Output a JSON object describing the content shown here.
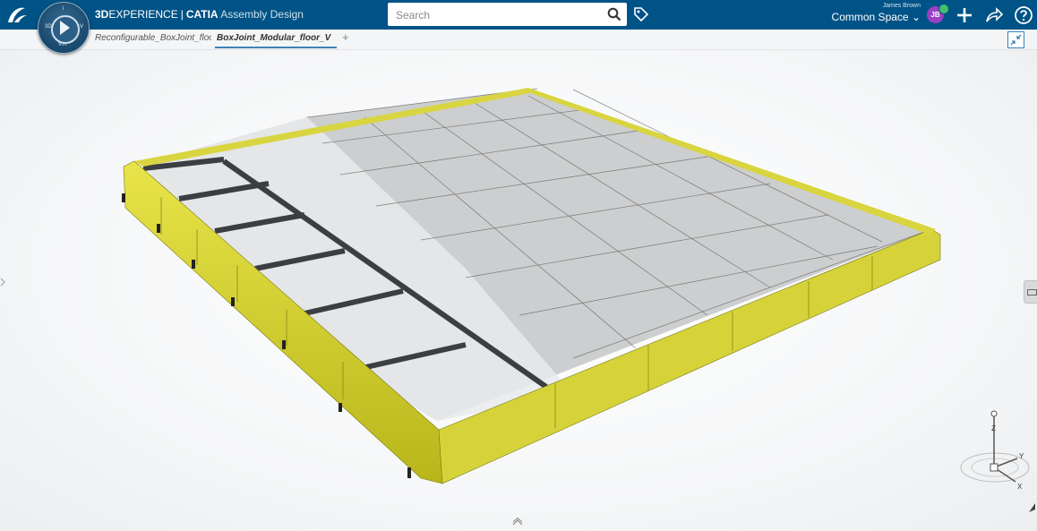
{
  "app": {
    "brand_bold": "3D",
    "brand_light": "EXPERIENCE",
    "separator": "|",
    "product": "CATIA",
    "module": "Assembly Design",
    "compass_labels": [
      "3D",
      "V.R",
      "i",
      "V"
    ]
  },
  "search": {
    "placeholder": "Search",
    "value": ""
  },
  "user": {
    "name": "James Brown",
    "space": "Common Space",
    "initials": "JB"
  },
  "tabs": [
    {
      "label": "Reconfigurable_BoxJoint_floor",
      "active": false
    },
    {
      "label": "BoxJoint_Modular_floor_V",
      "active": true
    }
  ],
  "tab_add": "+",
  "axis": {
    "z": "Z",
    "y": "Y",
    "x": "X"
  },
  "colors": {
    "topbar": "#005386",
    "frame_yellow": "#d4d42a",
    "panel_gray": "#c9cacb",
    "beam_dark": "#3b3e42",
    "active_tab_line": "#3d82b7"
  },
  "icons": [
    "ds-logo-icon",
    "compass-icon",
    "search-icon",
    "tag-icon",
    "add-icon",
    "share-icon",
    "help-icon",
    "collapse-icon"
  ]
}
